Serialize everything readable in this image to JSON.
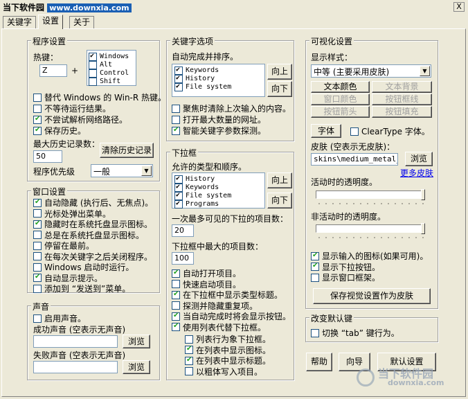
{
  "window": {
    "title": "当下软件园",
    "title_url": "www.downxia.com",
    "close_symbol": "X"
  },
  "tabs": [
    "关键字",
    "设置",
    "关于"
  ],
  "program_settings": {
    "title": "程序设置",
    "hotkey_label": "热键：",
    "hotkey_value": "Z",
    "plus": "+",
    "modifiers": [
      {
        "label": "Windows",
        "checked": true
      },
      {
        "label": "Alt",
        "checked": false
      },
      {
        "label": "Control",
        "checked": false
      },
      {
        "label": "Shift",
        "checked": false
      }
    ],
    "options": [
      {
        "label": "替代 Windows 的 Win-R 热键。",
        "checked": false
      },
      {
        "label": "不等待运行结果。",
        "checked": false
      },
      {
        "label": "不尝试解析网络路径。",
        "checked": true
      },
      {
        "label": "保存历史。",
        "checked": true
      }
    ],
    "max_history_label": "最大历史记录数：",
    "max_history_value": "50",
    "clear_history_button": "清除历史记录",
    "priority_label": "程序优先级",
    "priority_value": "一般"
  },
  "window_settings": {
    "title": "窗口设置",
    "options": [
      {
        "label": "自动隐藏 (执行后、无焦点)。",
        "checked": true
      },
      {
        "label": "光标处弹出菜单。",
        "checked": false
      },
      {
        "label": "隐藏时在系统托盘显示图标。",
        "checked": true
      },
      {
        "label": "总是在系统托盘显示图标。",
        "checked": false
      },
      {
        "label": "停留在最前。",
        "checked": false
      },
      {
        "label": "在每次关键字之后关闭程序。",
        "checked": false
      },
      {
        "label": "Windows 启动时运行。",
        "checked": false
      },
      {
        "label": "自动显示提示。",
        "checked": true
      },
      {
        "label": "添加到 “发送到”菜单。",
        "checked": false
      }
    ]
  },
  "sound": {
    "title": "声音",
    "enable_label": "启用声音。",
    "enable_checked": false,
    "success_label": "成功声音 (空表示无声音)",
    "success_value": "",
    "fail_label": "失败声音 (空表示无声音)",
    "fail_value": "",
    "browse_button": "浏览"
  },
  "keyword_options": {
    "title": "关键字选项",
    "autocomplete_label": "自动完成并排序。",
    "list": [
      {
        "label": "Keywords",
        "checked": true
      },
      {
        "label": "History",
        "checked": true
      },
      {
        "label": "File system",
        "checked": true
      }
    ],
    "up_button": "向上",
    "down_button": "向下",
    "options": [
      {
        "label": "聚焦时清除上次输入的内容。",
        "checked": false
      },
      {
        "label": "打开最大数量的网址。",
        "checked": false
      },
      {
        "label": "智能关键字参数探测。",
        "checked": true
      }
    ]
  },
  "dropdown": {
    "title": "下拉框",
    "types_label": "允许的类型和顺序。",
    "list": [
      {
        "label": "History",
        "checked": true
      },
      {
        "label": "Keywords",
        "checked": true
      },
      {
        "label": "File system",
        "checked": true
      },
      {
        "label": "Programs",
        "checked": true
      }
    ],
    "up_button": "向上",
    "down_button": "向下",
    "visible_items_label": "一次最多可见的下拉的项目数：",
    "visible_items_value": "20",
    "max_items_label": "下拉框中最大的项目数：",
    "max_items_value": "100",
    "options": [
      {
        "label": "自动打开项目。",
        "checked": true
      },
      {
        "label": "快速启动项目。",
        "checked": false
      },
      {
        "label": "在下拉框中显示类型标题。",
        "checked": true
      },
      {
        "label": "探测并隐藏重复项。",
        "checked": false
      },
      {
        "label": "当自动完成时将会显示按钮。",
        "checked": true
      },
      {
        "label": "使用列表代替下拉框。",
        "checked": true
      }
    ],
    "sub_options": [
      {
        "label": "列表行为象下拉框。",
        "checked": false
      },
      {
        "label": "在列表中显示图标。",
        "checked": true
      },
      {
        "label": "在列表中显示标题。",
        "checked": true
      },
      {
        "label": "以粗体写入项目。",
        "checked": false
      }
    ]
  },
  "visual": {
    "title": "可视化设置",
    "style_label": "显示样式：",
    "style_value": "中等 (主要采用皮肤)",
    "color_buttons": [
      {
        "label": "文本颜色",
        "enabled": true
      },
      {
        "label": "文本背景",
        "enabled": false
      },
      {
        "label": "窗口颜色",
        "enabled": false
      },
      {
        "label": "按钮框线",
        "enabled": false
      },
      {
        "label": "按钮箭头",
        "enabled": false
      },
      {
        "label": "按钮填充",
        "enabled": false
      }
    ],
    "font_button": "字体",
    "cleartype_label": "ClearType 字体。",
    "cleartype_checked": false,
    "skin_label": "皮肤 (空表示无皮肤)：",
    "skin_value": "skins\\medium_metal_bi",
    "browse_button": "浏览",
    "more_skins": "更多皮肤",
    "active_opacity_label": "活动时的透明度。",
    "active_opacity_level": 1.0,
    "inactive_opacity_label": "非活动时的透明度。",
    "inactive_opacity_level": 1.0,
    "options": [
      {
        "label": "显示输入的图标(如果可用)。",
        "checked": true
      },
      {
        "label": "显示下拉按钮。",
        "checked": true
      },
      {
        "label": "显示窗口框架。",
        "checked": false
      }
    ],
    "save_skin_button": "保存视觉设置作为皮肤"
  },
  "change_default_key": {
    "title": "改变默认键",
    "switch_label": "切换 “tab” 键行为。",
    "switch_checked": false
  },
  "bottom_buttons": {
    "help": "帮助",
    "wizard": "向导",
    "default": "默认设置"
  },
  "watermark": {
    "text": "当下软件园",
    "url": "downxia.com"
  },
  "colors": {
    "face": "#ece9d8",
    "accent": "#1a5fb4",
    "check": "#21a121"
  }
}
